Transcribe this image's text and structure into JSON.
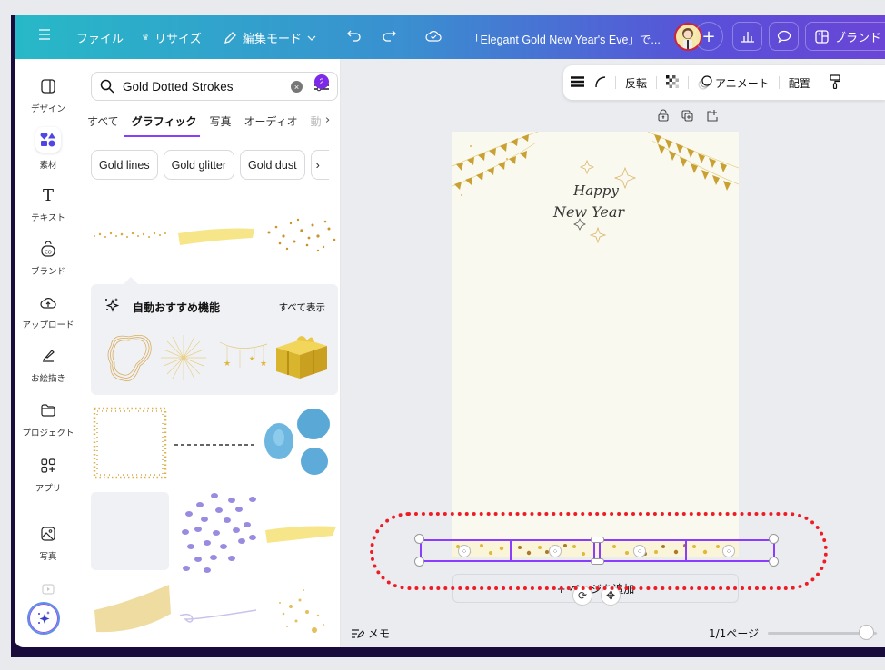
{
  "topbar": {
    "menu_icon": "hamburger-icon",
    "file_label": "ファイル",
    "resize_label": "リサイズ",
    "edit_mode_label": "編集モード",
    "document_title": "「Elegant Gold New Year's Eve」で...",
    "brand_label": "ブランド",
    "colors": {
      "gradient_start": "#27b9c7",
      "gradient_end": "#6a45d6"
    }
  },
  "rail": {
    "items": [
      {
        "label": "デザイン",
        "icon": "layout-icon"
      },
      {
        "label": "素材",
        "icon": "elements-icon",
        "active": true
      },
      {
        "label": "テキスト",
        "icon": "text-icon"
      },
      {
        "label": "ブランド",
        "icon": "brand-icon"
      },
      {
        "label": "アップロード",
        "icon": "upload-cloud-icon"
      },
      {
        "label": "お絵描き",
        "icon": "draw-icon"
      },
      {
        "label": "プロジェクト",
        "icon": "folder-icon"
      },
      {
        "label": "アプリ",
        "icon": "apps-icon"
      },
      {
        "label": "写真",
        "icon": "photo-icon"
      }
    ]
  },
  "panel": {
    "search": {
      "value": "Gold Dotted Strokes",
      "filter_count": "2"
    },
    "tabs": [
      "すべて",
      "グラフィック",
      "写真",
      "オーディオ",
      "動"
    ],
    "active_tab": "グラフィック",
    "chips": [
      "Gold lines",
      "Gold glitter",
      "Gold dust"
    ],
    "recommend": {
      "title": "自動おすすめ機能",
      "see_all": "すべて表示"
    }
  },
  "canvas": {
    "toolbar": {
      "flip": "反転",
      "animate": "アニメート",
      "position": "配置"
    },
    "card_text_line1": "Happy",
    "card_text_line2": "New Year",
    "add_page": "+ ページを追加"
  },
  "footer": {
    "notes": "メモ",
    "page_count": "1/1ページ",
    "zoom_fraction": 0.9
  }
}
